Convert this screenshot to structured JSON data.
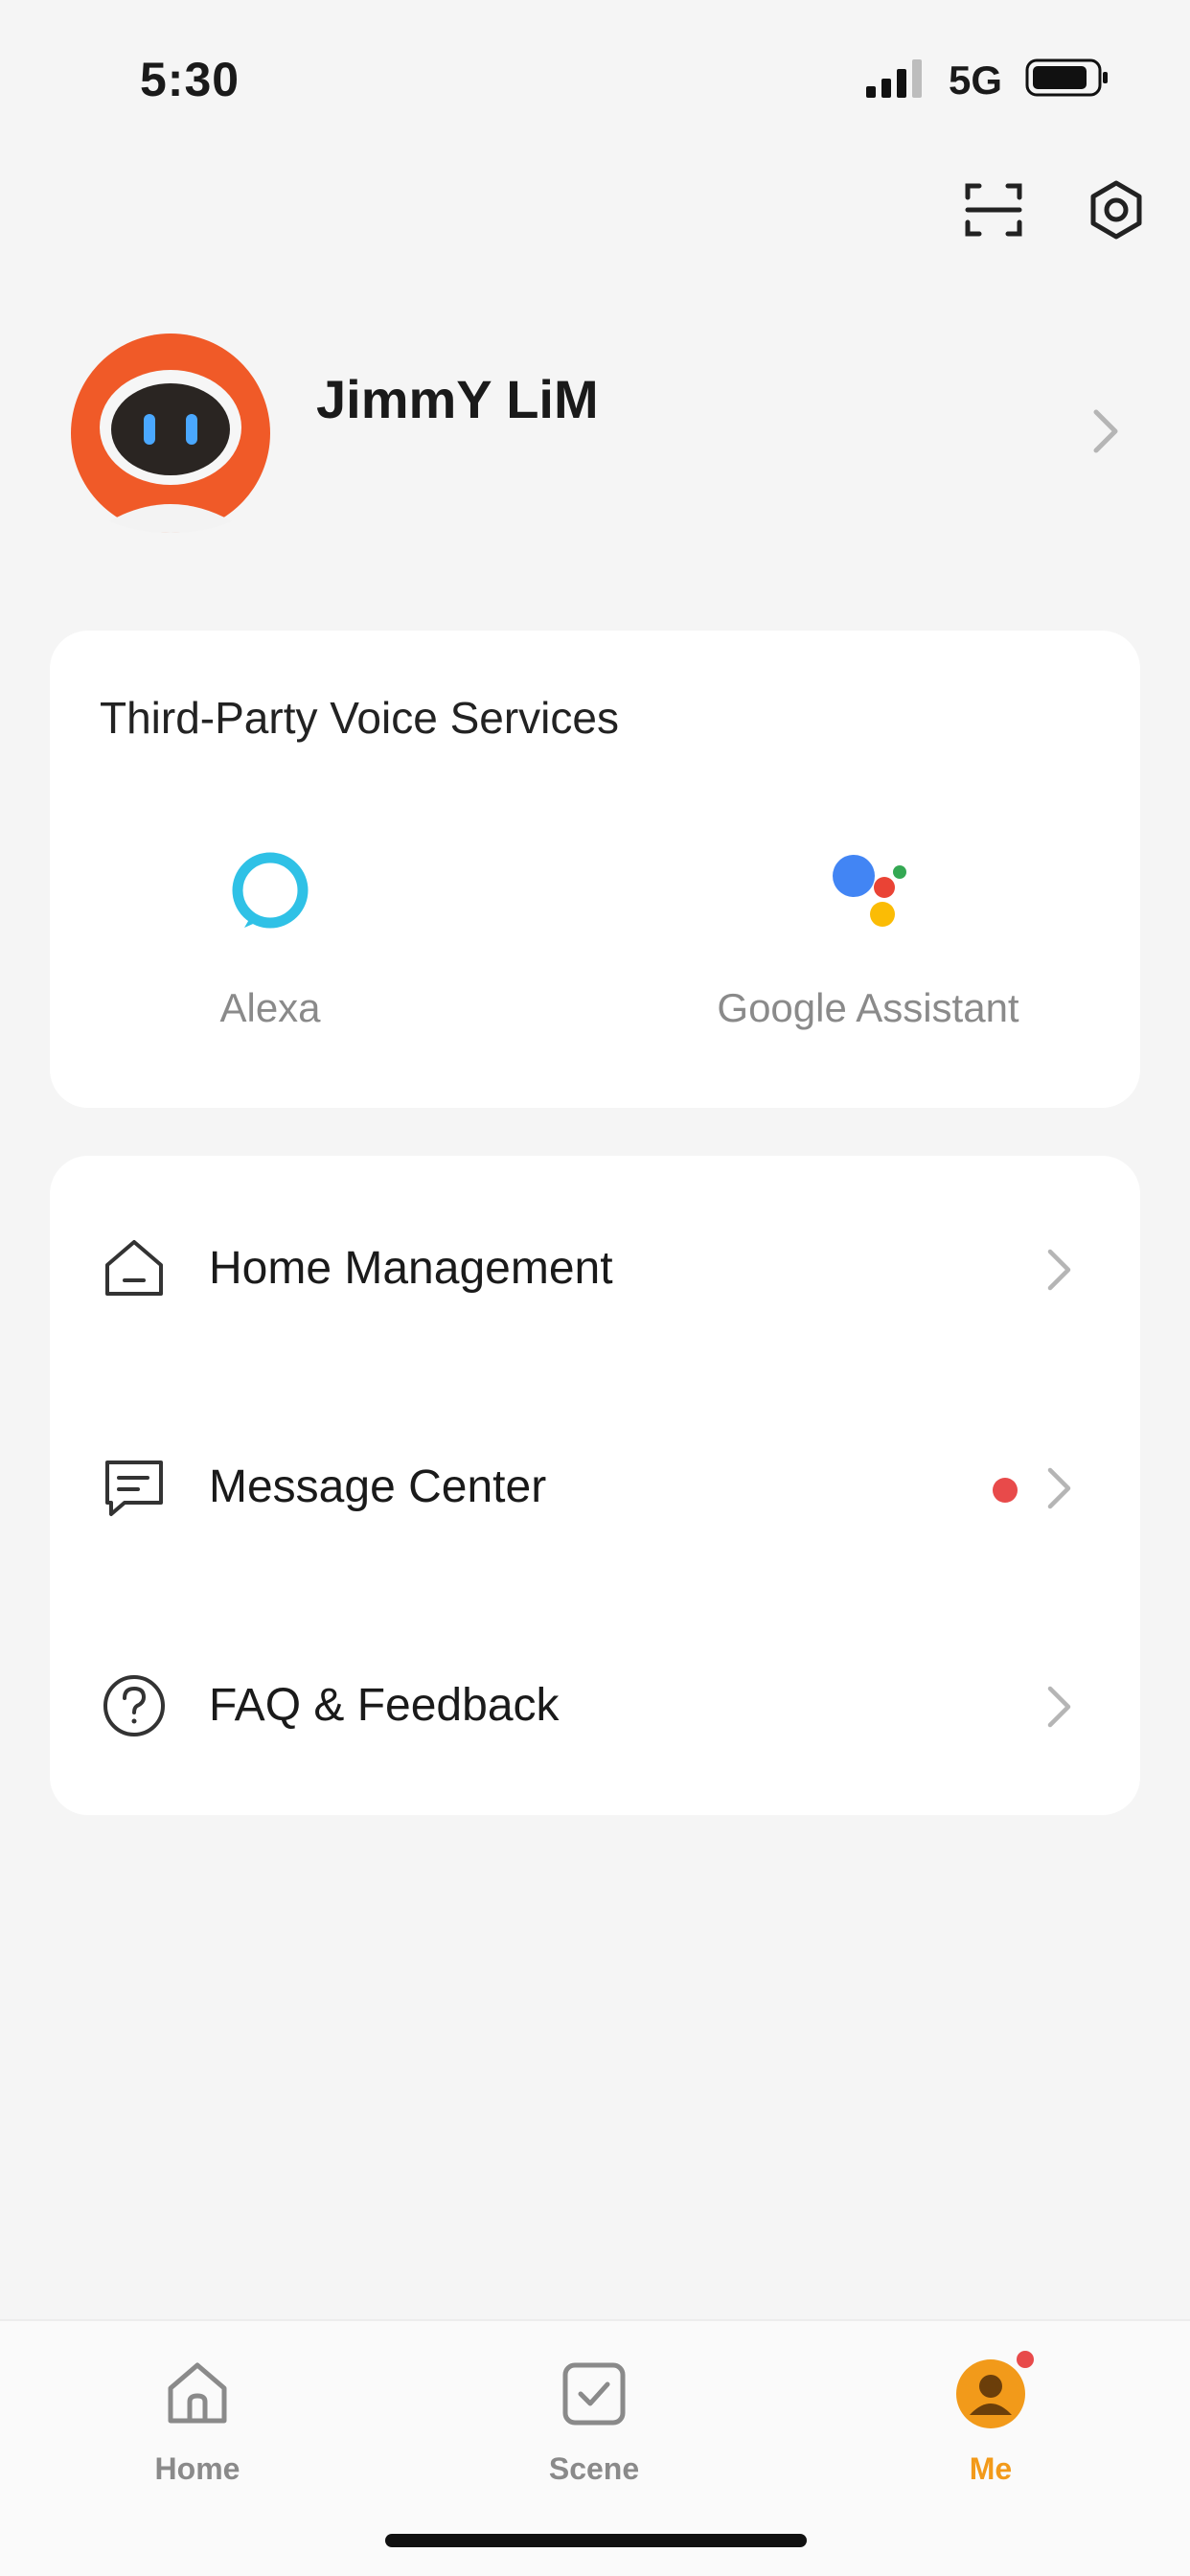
{
  "status_bar": {
    "time": "5:30",
    "network": "5G"
  },
  "header": {
    "scan_icon": "scan-icon",
    "settings_icon": "settings-icon"
  },
  "profile": {
    "name": "JimmY LiM",
    "avatar": "robot-avatar"
  },
  "voice_services": {
    "title": "Third-Party Voice Services",
    "items": [
      {
        "label": "Alexa",
        "icon": "alexa-icon",
        "color": "#2fc1e6"
      },
      {
        "label": "Google Assistant",
        "icon": "google-assistant-icon"
      }
    ]
  },
  "menu": {
    "items": [
      {
        "label": "Home Management",
        "icon": "home-icon"
      },
      {
        "label": "Message Center",
        "icon": "message-icon",
        "has_unread": true
      },
      {
        "label": "FAQ & Feedback",
        "icon": "question-icon"
      }
    ]
  },
  "tabbar": {
    "tabs": [
      {
        "label": "Home",
        "icon": "home-tab-icon",
        "active": false
      },
      {
        "label": "Scene",
        "icon": "scene-tab-icon",
        "active": false
      },
      {
        "label": "Me",
        "icon": "me-tab-icon",
        "active": true,
        "badge": true
      }
    ]
  },
  "colors": {
    "accent": "#f29a1a",
    "badge": "#e84a4a",
    "avatar_orange": "#f05a28",
    "background": "#f5f5f5"
  }
}
